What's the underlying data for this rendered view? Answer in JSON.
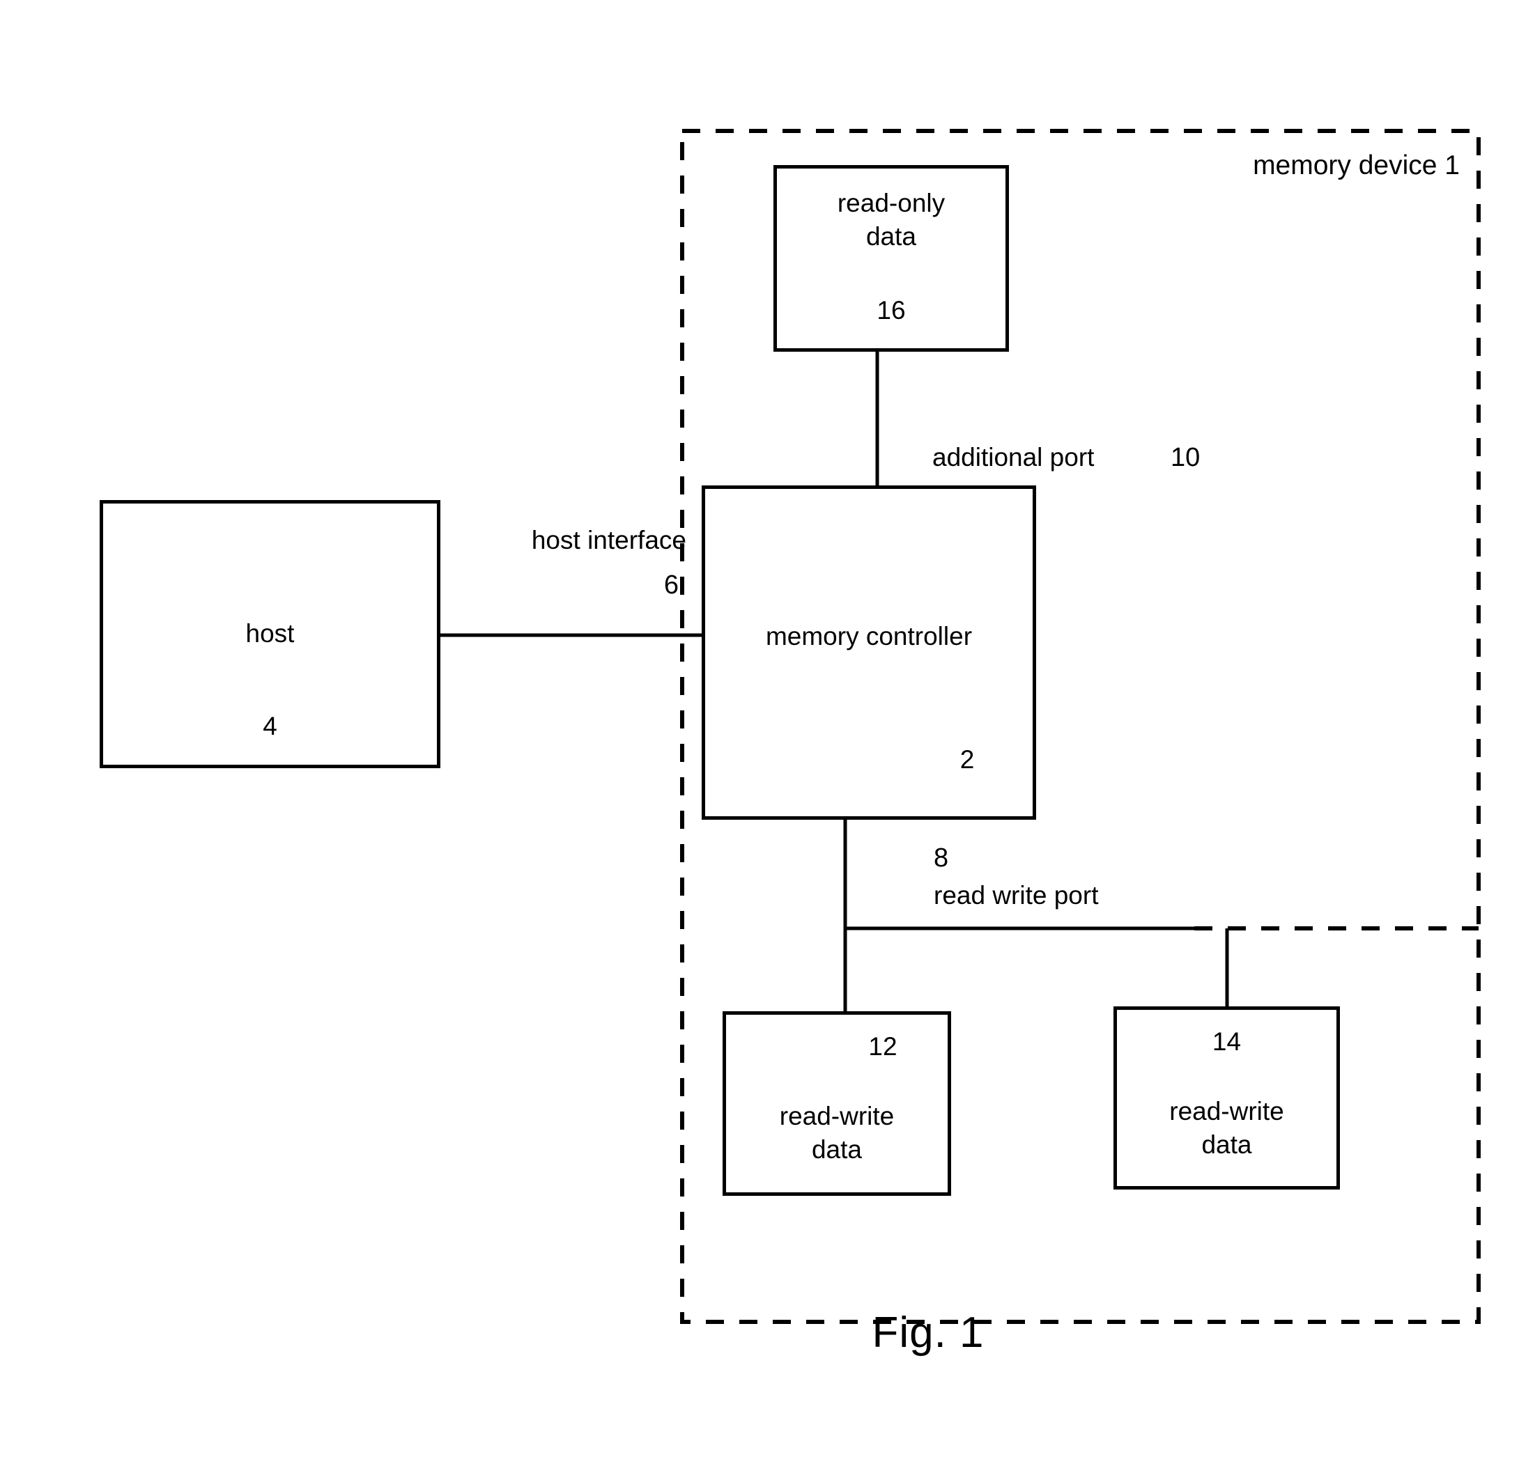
{
  "figure": {
    "caption": "Fig. 1",
    "device_boundary_label": "memory device 1"
  },
  "blocks": {
    "read_only_data": {
      "title": "read-only\ndata",
      "ref": "16"
    },
    "host": {
      "title": "host",
      "ref": "4"
    },
    "memory_controller": {
      "title": "memory controller",
      "ref": "2"
    },
    "read_write_data_left": {
      "title": "read-write\ndata",
      "ref": "12"
    },
    "read_write_data_right": {
      "title": "read-write\ndata",
      "ref": "14"
    }
  },
  "connections": {
    "host_interface": {
      "label": "host interface",
      "ref": "6"
    },
    "additional_port": {
      "label": "additional port",
      "ref": "10"
    },
    "read_write_port": {
      "label": "read write port",
      "ref": "8"
    }
  },
  "colors": {
    "ink": "#000000",
    "paper": "#ffffff"
  }
}
